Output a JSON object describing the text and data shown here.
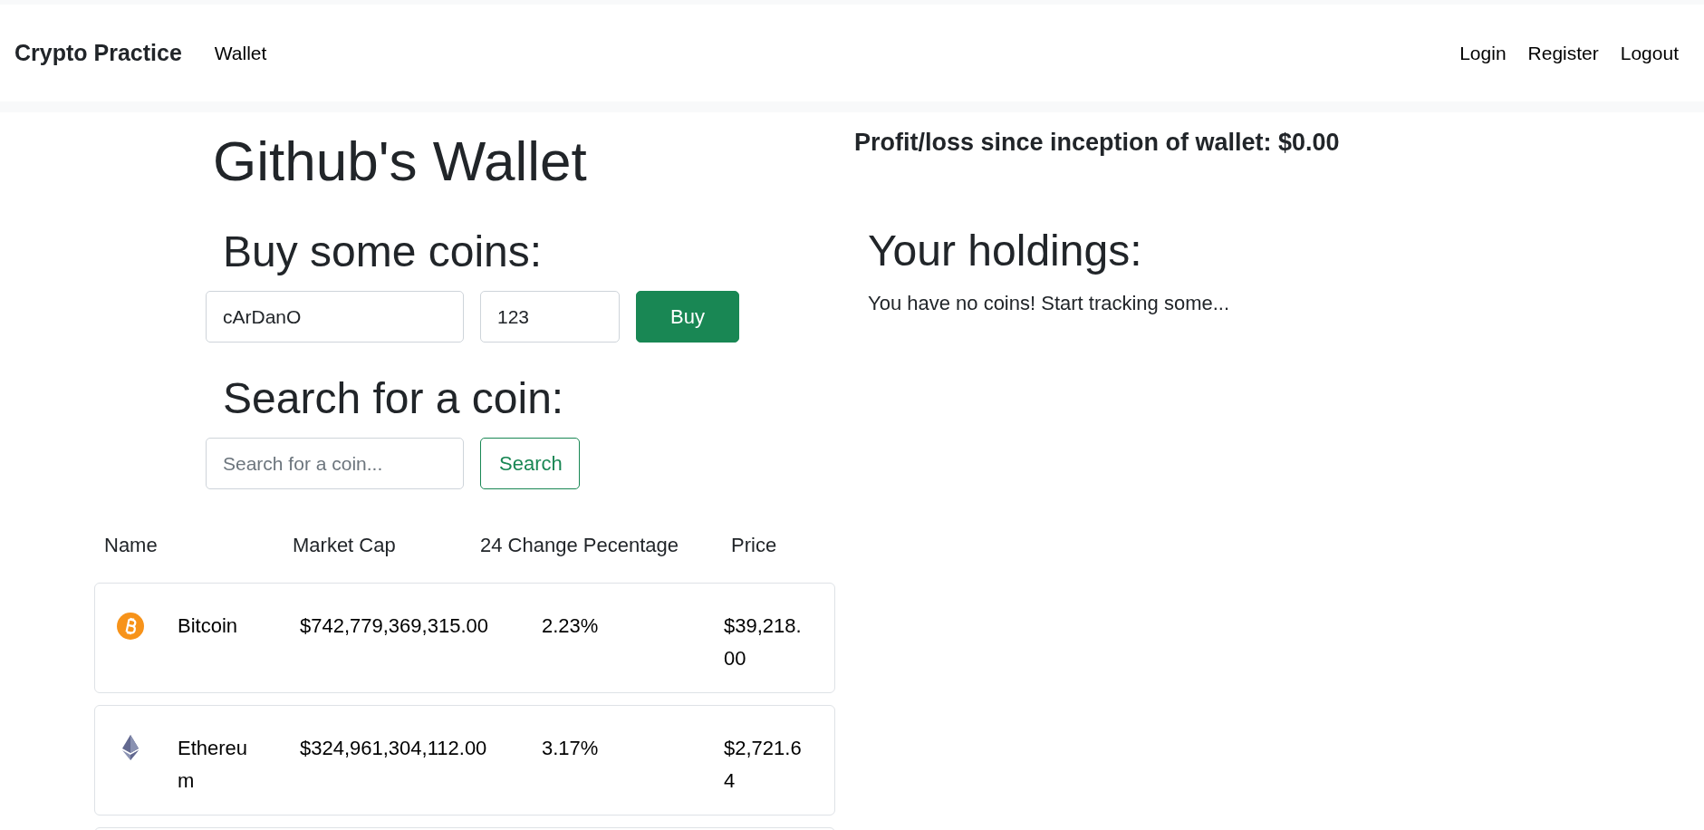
{
  "navbar": {
    "brand": "Crypto Practice",
    "links": [
      {
        "label": "Wallet"
      }
    ],
    "right_links": [
      {
        "label": "Login"
      },
      {
        "label": "Register"
      },
      {
        "label": "Logout"
      }
    ]
  },
  "wallet_title": "Github's Wallet",
  "buy": {
    "heading": "Buy some coins:",
    "coin_value": "cArDanO",
    "amount_value": "123",
    "button": "Buy"
  },
  "search": {
    "heading": "Search for a coin:",
    "placeholder": "Search for a coin...",
    "button": "Search"
  },
  "table": {
    "columns": [
      "Name",
      "Market Cap",
      "24 Change Pecentage",
      "Price"
    ],
    "rows": [
      {
        "kind": "coin",
        "name": "Bitcoin",
        "market_cap": "$742,779,369,315.00",
        "change": "2.23%",
        "price": "$39,218.00"
      },
      {
        "kind": "diamond",
        "name": "Ethereum",
        "market_cap": "$324,961,304,112.00",
        "change": "3.17%",
        "price": "$2,721.64"
      }
    ]
  },
  "profit": "Profit/loss since inception of wallet: $0.00",
  "holdings": {
    "heading": "Your holdings:",
    "empty_message": "You have no coins! Start tracking some..."
  }
}
